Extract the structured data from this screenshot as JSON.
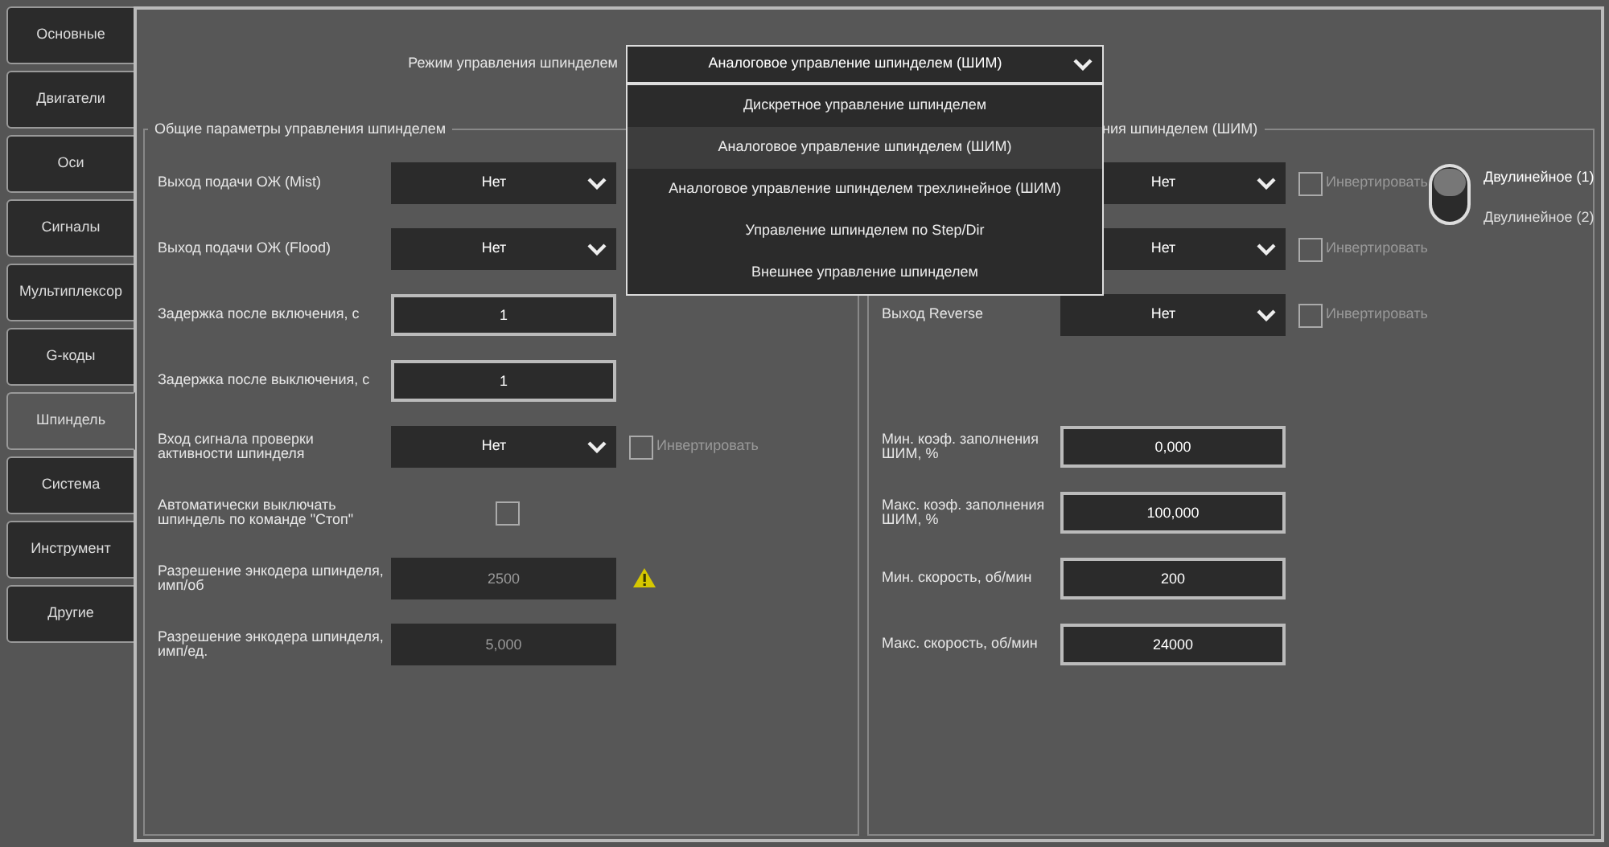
{
  "tabs": [
    {
      "label": "Основные",
      "selected": false
    },
    {
      "label": "Двигатели",
      "selected": false
    },
    {
      "label": "Оси",
      "selected": false
    },
    {
      "label": "Сигналы",
      "selected": false
    },
    {
      "label": "Мультиплексор",
      "selected": false
    },
    {
      "label": "G-коды",
      "selected": false
    },
    {
      "label": "Шпиндель",
      "selected": true
    },
    {
      "label": "Система",
      "selected": false
    },
    {
      "label": "Инструмент",
      "selected": false
    },
    {
      "label": "Другие",
      "selected": false
    }
  ],
  "mode": {
    "label": "Режим управления шпинделем",
    "value": "Аналоговое управление шпинделем (ШИМ)",
    "expanded": true,
    "options": [
      {
        "label": "Дискретное управление шпинделем",
        "selected": false
      },
      {
        "label": "Аналоговое управление шпинделем (ШИМ)",
        "selected": true
      },
      {
        "label": "Аналоговое управление шпинделем трехлинейное (ШИМ)",
        "selected": false
      },
      {
        "label": "Управление шпинделем по Step/Dir",
        "selected": false
      },
      {
        "label": "Внешнее управление шпинделем",
        "selected": false
      }
    ]
  },
  "left_group": {
    "title": "Общие параметры управления шпинделем",
    "rows": [
      {
        "kind": "select",
        "label": "Выход подачи ОЖ (Mist)",
        "value": "Нет"
      },
      {
        "kind": "select",
        "label": "Выход подачи ОЖ (Flood)",
        "value": "Нет"
      },
      {
        "kind": "input",
        "label": "Задержка после включения, с",
        "value": "1",
        "disabled": false
      },
      {
        "kind": "input",
        "label": "Задержка после выключения, с",
        "value": "1",
        "disabled": false
      },
      {
        "kind": "select",
        "label": "Вход сигнала проверки активности шпинделя",
        "value": "Нет",
        "invert": {
          "label": "Инвертировать",
          "checked": false
        }
      },
      {
        "kind": "checkbox",
        "label": "Автоматически выключать шпиндель по команде \"Стоп\"",
        "checked": false
      },
      {
        "kind": "input",
        "label": "Разрешение энкодера шпинделя, имп/об",
        "value": "2500",
        "disabled": true,
        "warning": true
      },
      {
        "kind": "input",
        "label": "Разрешение энкодера шпинделя, имп/ед.",
        "value": "5,000",
        "disabled": true
      }
    ]
  },
  "right_group": {
    "title": "ния шпинделем (ШИМ)",
    "outputs": [
      {
        "kind": "select",
        "value": "Нет",
        "invert": {
          "label": "Инвертировать",
          "checked": false
        }
      },
      {
        "kind": "select",
        "value": "Нет",
        "invert": {
          "label": "Инвертировать",
          "checked": false
        }
      },
      {
        "kind": "select",
        "label": "Выход Reverse",
        "value": "Нет",
        "invert": {
          "label": "Инвертировать",
          "checked": false
        }
      }
    ],
    "toggle": {
      "options": [
        {
          "label": "Двулинейное (1)",
          "selected": true
        },
        {
          "label": "Двулинейное (2)",
          "selected": false
        }
      ]
    },
    "limits": [
      {
        "kind": "input",
        "label": "Мин. коэф. заполнения ШИМ, %",
        "value": "0,000",
        "disabled": false
      },
      {
        "kind": "input",
        "label": "Макс. коэф. заполнения ШИМ, %",
        "value": "100,000",
        "disabled": false
      },
      {
        "kind": "input",
        "label": "Мин. скорость, об/мин",
        "value": "200",
        "disabled": false
      },
      {
        "kind": "input",
        "label": "Макс. скорость, об/мин",
        "value": "24000",
        "disabled": false
      }
    ]
  }
}
